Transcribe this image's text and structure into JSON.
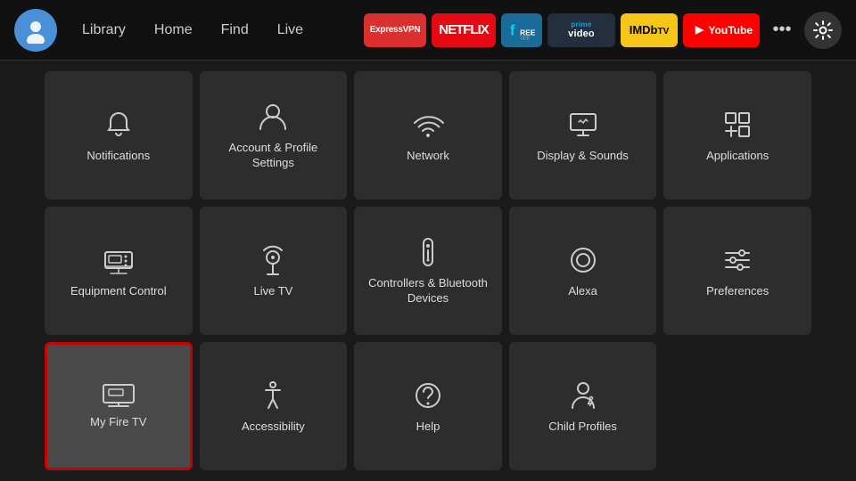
{
  "nav": {
    "links": [
      "Library",
      "Home",
      "Find",
      "Live"
    ],
    "apps": [
      {
        "name": "ExpressVPN",
        "key": "expressvpn",
        "label": "ExpressVPN"
      },
      {
        "name": "Netflix",
        "key": "netflix",
        "label": "NETFLIX"
      },
      {
        "name": "Freevee",
        "key": "freevee",
        "label": "f"
      },
      {
        "name": "Prime Video",
        "key": "primevideo",
        "label": "prime video"
      },
      {
        "name": "IMDb TV",
        "key": "imdb",
        "label": "IMDbTV"
      },
      {
        "name": "YouTube",
        "key": "youtube",
        "label": "▶ YouTube"
      }
    ]
  },
  "grid": {
    "items": [
      {
        "id": "notifications",
        "label": "Notifications",
        "icon": "bell"
      },
      {
        "id": "account-profile",
        "label": "Account & Profile Settings",
        "icon": "person"
      },
      {
        "id": "network",
        "label": "Network",
        "icon": "wifi"
      },
      {
        "id": "display-sounds",
        "label": "Display & Sounds",
        "icon": "display"
      },
      {
        "id": "applications",
        "label": "Applications",
        "icon": "apps"
      },
      {
        "id": "equipment-control",
        "label": "Equipment Control",
        "icon": "tv"
      },
      {
        "id": "live-tv",
        "label": "Live TV",
        "icon": "antenna"
      },
      {
        "id": "controllers-bluetooth",
        "label": "Controllers & Bluetooth Devices",
        "icon": "remote"
      },
      {
        "id": "alexa",
        "label": "Alexa",
        "icon": "alexa"
      },
      {
        "id": "preferences",
        "label": "Preferences",
        "icon": "sliders"
      },
      {
        "id": "my-fire-tv",
        "label": "My Fire TV",
        "icon": "firetv",
        "selected": true
      },
      {
        "id": "accessibility",
        "label": "Accessibility",
        "icon": "accessibility"
      },
      {
        "id": "help",
        "label": "Help",
        "icon": "help"
      },
      {
        "id": "child-profiles",
        "label": "Child Profiles",
        "icon": "child"
      }
    ]
  }
}
